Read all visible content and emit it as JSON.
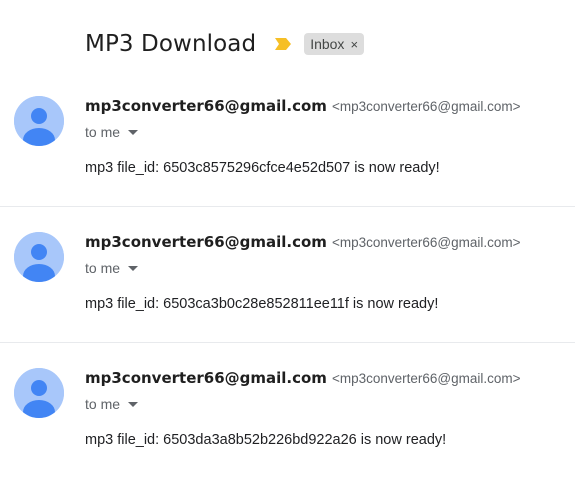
{
  "thread": {
    "subject": "MP3 Download",
    "label_chip": "Inbox",
    "label_close": "×",
    "importance_icon": "importance-marker-icon",
    "colors": {
      "importance": "#f6bf26",
      "avatar_bg": "#a8c7fa",
      "avatar_fg": "#4285f4"
    }
  },
  "messages": [
    {
      "sender_name": "mp3converter66@gmail.com",
      "sender_email": "<mp3converter66@gmail.com>",
      "recipient": "to me",
      "body": "mp3 file_id: 6503c8575296cfce4e52d507 is now ready!"
    },
    {
      "sender_name": "mp3converter66@gmail.com",
      "sender_email": "<mp3converter66@gmail.com>",
      "recipient": "to me",
      "body": "mp3 file_id: 6503ca3b0c28e852811ee11f is now ready!"
    },
    {
      "sender_name": "mp3converter66@gmail.com",
      "sender_email": "<mp3converter66@gmail.com>",
      "recipient": "to me",
      "body": "mp3 file_id: 6503da3a8b52b226bd922a26 is now ready!"
    }
  ]
}
